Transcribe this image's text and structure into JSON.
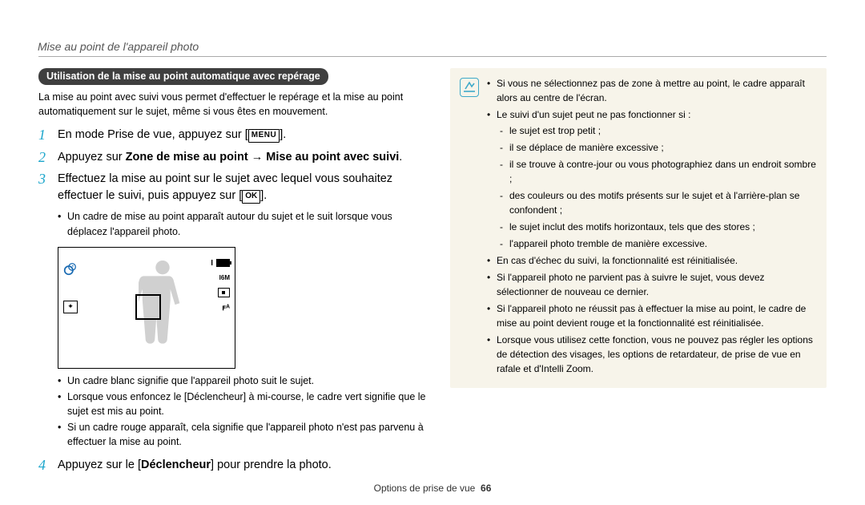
{
  "header": "Mise au point de l'appareil photo",
  "section_title": "Utilisation de la mise au point automatique avec repérage",
  "intro": "La mise au point avec suivi vous permet d'effectuer le repérage et la mise au point automatiquement sur le sujet, même si vous êtes en mouvement.",
  "steps": {
    "s1_pre": "En mode Prise de vue, appuyez sur [",
    "s1_menu": "MENU",
    "s1_post": "].",
    "s2_pre": "Appuyez sur ",
    "s2_bold1": "Zone de mise au point",
    "s2_arrow": " → ",
    "s2_bold2": "Mise au point avec suivi",
    "s2_post": ".",
    "s3_line1": "Effectuez la mise au point sur le sujet avec lequel vous souhaitez",
    "s3_line2_pre": "effectuer le suivi, puis appuyez sur [",
    "s3_ok": "OK",
    "s3_line2_post": "].",
    "s4_pre": "Appuyez sur le [",
    "s4_bold": "Déclencheur",
    "s4_post": "] pour prendre la photo."
  },
  "step3_bullets": {
    "b1": "Un cadre de mise au point apparaît autour du sujet et le suit lorsque vous déplacez l'appareil photo."
  },
  "lcd": {
    "count": "I",
    "res": "I6M",
    "flash": "ꜰᴬ"
  },
  "below_lcd": {
    "b1": "Un cadre blanc signifie que l'appareil photo suit le sujet.",
    "b2_pre": "Lorsque vous enfoncez le [",
    "b2_bold": "Déclencheur",
    "b2_post": "] à mi-course, le cadre vert signifie que le sujet est mis au point.",
    "b3": "Si un cadre rouge apparaît, cela signifie que l'appareil photo n'est pas parvenu à effectuer la mise au point."
  },
  "notes": {
    "n1": "Si vous ne sélectionnez pas de zone à mettre au point, le cadre apparaît alors au centre de l'écran.",
    "n2": "Le suivi d'un sujet peut ne pas fonctionner si :",
    "n2a": "le sujet est trop petit ;",
    "n2b": "il se déplace de manière excessive ;",
    "n2c": "il se trouve à contre-jour ou vous photographiez dans un endroit sombre ;",
    "n2d": "des couleurs ou des motifs présents sur le sujet et à l'arrière-plan se confondent ;",
    "n2e": "le sujet inclut des motifs horizontaux, tels que des stores ;",
    "n2f": "l'appareil photo tremble de manière excessive.",
    "n3": "En cas d'échec du suivi, la fonctionnalité est réinitialisée.",
    "n4": "Si l'appareil photo ne parvient pas à suivre le sujet, vous devez sélectionner de nouveau ce dernier.",
    "n5": "Si l'appareil photo ne réussit pas à effectuer la mise au point, le cadre de mise au point devient rouge et la fonctionnalité est réinitialisée.",
    "n6": "Lorsque vous utilisez cette fonction, vous ne pouvez pas régler les options de détection des visages, les options de retardateur, de prise de vue en rafale et d'Intelli Zoom."
  },
  "footer_label": "Options de prise de vue",
  "footer_page": "66"
}
